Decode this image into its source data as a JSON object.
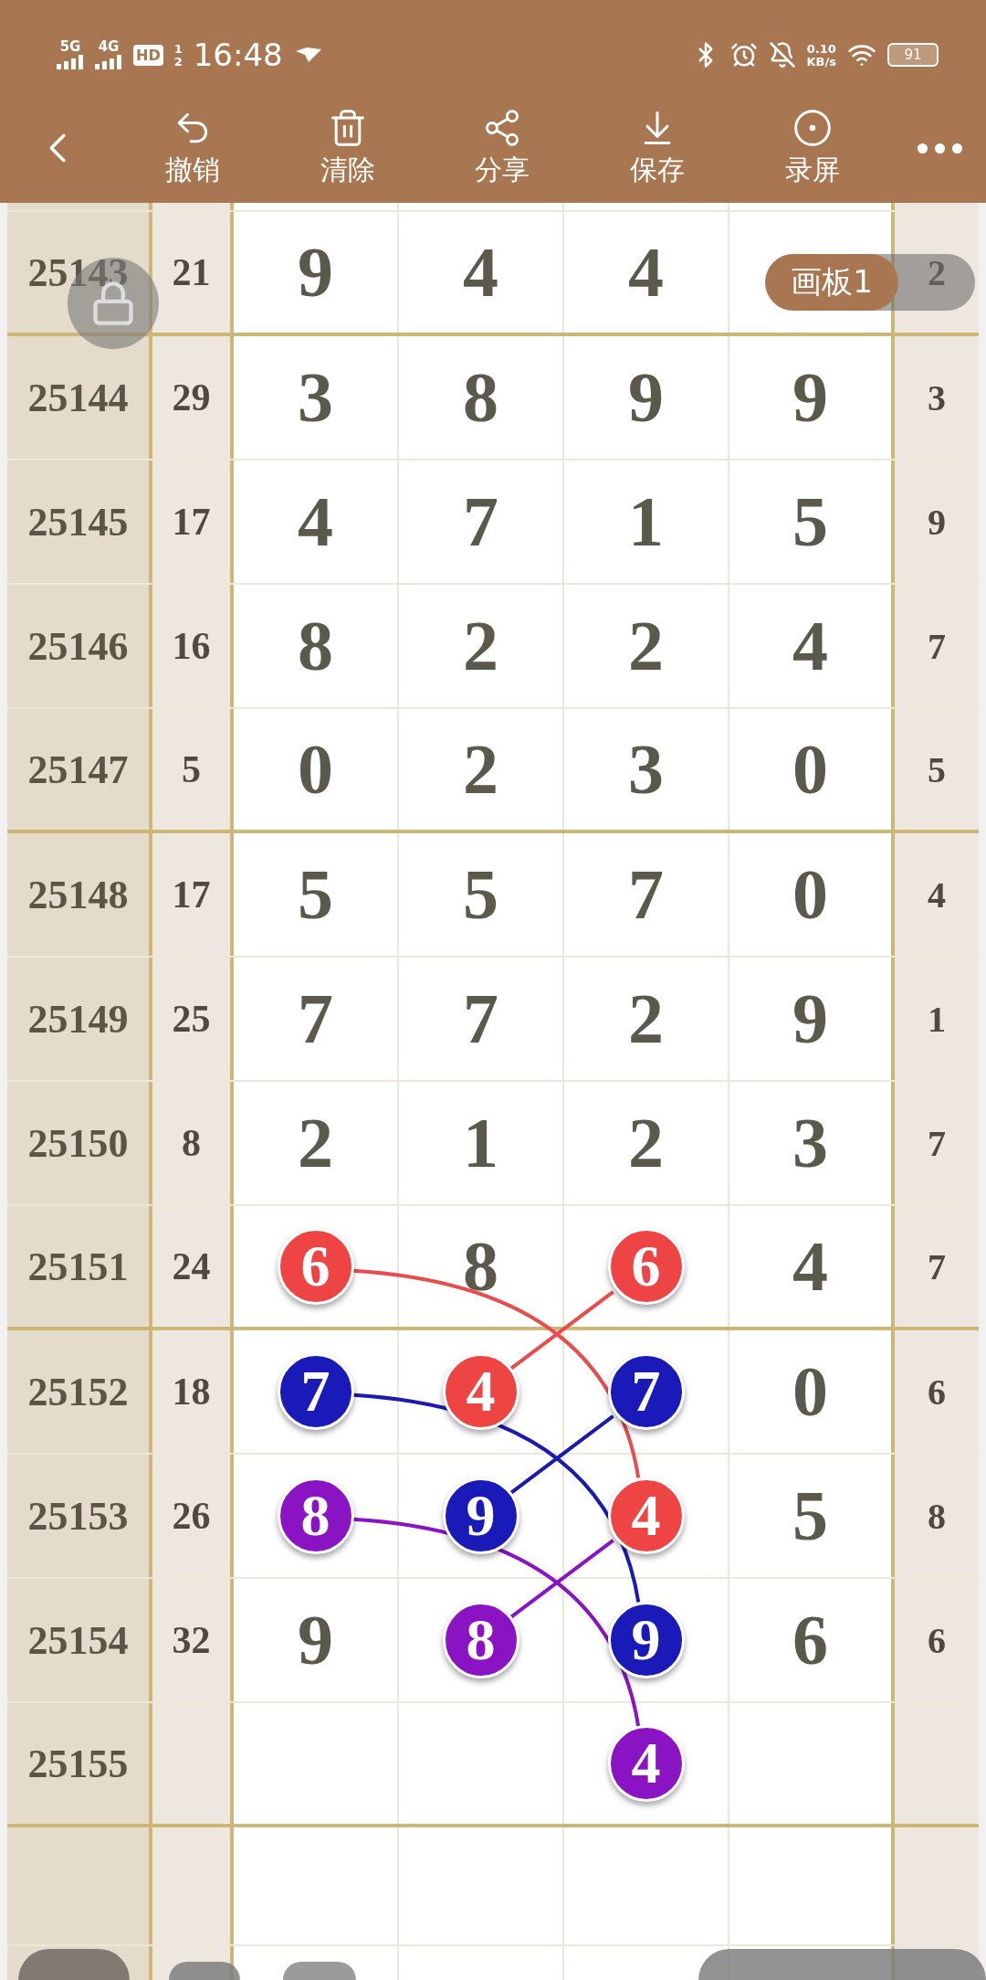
{
  "status_bar": {
    "network_1": "5G",
    "network_2": "4G",
    "hd": "HD",
    "hd_slots": [
      "1",
      "2"
    ],
    "time": "16:48",
    "speed_value": "0.10",
    "speed_unit": "KB/s",
    "battery": "91"
  },
  "toolbar": {
    "items": [
      {
        "kind": "undo",
        "label": "撤销"
      },
      {
        "kind": "clear",
        "label": "清除"
      },
      {
        "kind": "share",
        "label": "分享"
      },
      {
        "kind": "save",
        "label": "保存"
      },
      {
        "kind": "record",
        "label": "录屏"
      }
    ]
  },
  "board_tab": {
    "label": "画板1"
  },
  "rows": [
    {
      "issue": "25143",
      "sum": "21",
      "digits": [
        {
          "kind": "plain",
          "value": "9"
        },
        {
          "kind": "plain",
          "value": "4"
        },
        {
          "kind": "plain",
          "value": "4"
        }
      ],
      "tail": "2",
      "divider_below": true
    },
    {
      "issue": "25144",
      "sum": "29",
      "digits": [
        {
          "kind": "plain",
          "value": "3"
        },
        {
          "kind": "plain",
          "value": "8"
        },
        {
          "kind": "plain",
          "value": "9"
        },
        {
          "kind": "plain",
          "value": "9"
        }
      ],
      "tail": "3",
      "divider_below": false
    },
    {
      "issue": "25145",
      "sum": "17",
      "digits": [
        {
          "kind": "plain",
          "value": "4"
        },
        {
          "kind": "plain",
          "value": "7"
        },
        {
          "kind": "plain",
          "value": "1"
        },
        {
          "kind": "plain",
          "value": "5"
        }
      ],
      "tail": "9",
      "divider_below": false
    },
    {
      "issue": "25146",
      "sum": "16",
      "digits": [
        {
          "kind": "plain",
          "value": "8"
        },
        {
          "kind": "plain",
          "value": "2"
        },
        {
          "kind": "plain",
          "value": "2"
        },
        {
          "kind": "plain",
          "value": "4"
        }
      ],
      "tail": "7",
      "divider_below": false
    },
    {
      "issue": "25147",
      "sum": "5",
      "digits": [
        {
          "kind": "plain",
          "value": "0"
        },
        {
          "kind": "plain",
          "value": "2"
        },
        {
          "kind": "plain",
          "value": "3"
        },
        {
          "kind": "plain",
          "value": "0"
        }
      ],
      "tail": "5",
      "divider_below": true
    },
    {
      "issue": "25148",
      "sum": "17",
      "digits": [
        {
          "kind": "plain",
          "value": "5"
        },
        {
          "kind": "plain",
          "value": "5"
        },
        {
          "kind": "plain",
          "value": "7"
        },
        {
          "kind": "plain",
          "value": "0"
        }
      ],
      "tail": "4",
      "divider_below": false
    },
    {
      "issue": "25149",
      "sum": "25",
      "digits": [
        {
          "kind": "plain",
          "value": "7"
        },
        {
          "kind": "plain",
          "value": "7"
        },
        {
          "kind": "plain",
          "value": "2"
        },
        {
          "kind": "plain",
          "value": "9"
        }
      ],
      "tail": "1",
      "divider_below": false
    },
    {
      "issue": "25150",
      "sum": "8",
      "digits": [
        {
          "kind": "plain",
          "value": "2"
        },
        {
          "kind": "plain",
          "value": "1"
        },
        {
          "kind": "plain",
          "value": "2"
        },
        {
          "kind": "plain",
          "value": "3"
        }
      ],
      "tail": "7",
      "divider_below": false
    },
    {
      "issue": "25151",
      "sum": "24",
      "digits": [
        {
          "kind": "ball",
          "value": "6",
          "color": "#ee4444"
        },
        {
          "kind": "plain",
          "value": "8"
        },
        {
          "kind": "ball",
          "value": "6",
          "color": "#ee4444"
        },
        {
          "kind": "plain",
          "value": "4"
        }
      ],
      "tail": "7",
      "divider_below": true
    },
    {
      "issue": "25152",
      "sum": "18",
      "digits": [
        {
          "kind": "ball",
          "value": "7",
          "color": "#1a1ab8"
        },
        {
          "kind": "ball",
          "value": "4",
          "color": "#ee4444"
        },
        {
          "kind": "ball",
          "value": "7",
          "color": "#1a1ab8"
        },
        {
          "kind": "plain",
          "value": "0"
        }
      ],
      "tail": "6",
      "divider_below": false
    },
    {
      "issue": "25153",
      "sum": "26",
      "digits": [
        {
          "kind": "ball",
          "value": "8",
          "color": "#8a14c4"
        },
        {
          "kind": "ball",
          "value": "9",
          "color": "#1a1ab8"
        },
        {
          "kind": "ball",
          "value": "4",
          "color": "#ee4444"
        },
        {
          "kind": "plain",
          "value": "5"
        }
      ],
      "tail": "8",
      "divider_below": false
    },
    {
      "issue": "25154",
      "sum": "32",
      "digits": [
        {
          "kind": "plain",
          "value": "9"
        },
        {
          "kind": "ball",
          "value": "8",
          "color": "#8a14c4"
        },
        {
          "kind": "ball",
          "value": "9",
          "color": "#1a1ab8"
        },
        {
          "kind": "plain",
          "value": "6"
        }
      ],
      "tail": "6",
      "divider_below": false
    },
    {
      "issue": "25155",
      "digits": [
        {
          "kind": "empty"
        },
        {
          "kind": "empty"
        },
        {
          "kind": "ball",
          "value": "4",
          "color": "#8a14c4"
        },
        {
          "kind": "empty"
        }
      ],
      "divider_below": true
    }
  ]
}
